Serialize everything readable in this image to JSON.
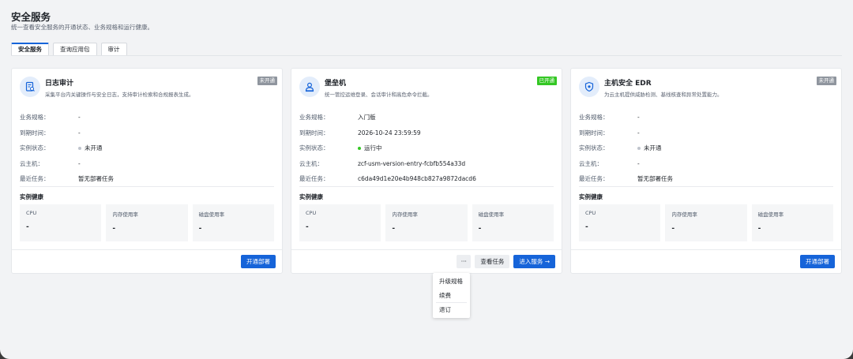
{
  "page": {
    "title": "安全服务",
    "subtitle": "统一查看安全服务的开通状态、业务规格和运行健康。"
  },
  "tabs": [
    {
      "label": "安全服务",
      "active": true
    },
    {
      "label": "查询应用包",
      "active": false
    },
    {
      "label": "审计",
      "active": false
    }
  ],
  "row_labels": {
    "spec": "业务规格：",
    "expire": "到期时间：",
    "status": "实例状态：",
    "host": "云主机：",
    "task": "最近任务："
  },
  "health": {
    "title": "实例健康",
    "cpu": "CPU",
    "mem": "内存使用率",
    "disk": "磁盘使用率"
  },
  "cards": [
    {
      "name": "日志审计",
      "desc": "采集平台内关键操作与安全日志，支持审计检索和合规报表生成。",
      "icon": "log-audit-icon",
      "badge": "未开通",
      "spec": "-",
      "expire": "-",
      "status": "未开通",
      "host": "-",
      "task": "暂无部署任务",
      "cpu": "-",
      "mem": "-",
      "disk": "-",
      "primary_button": "开通部署"
    },
    {
      "name": "堡垒机",
      "desc": "统一管控运维登录、会话审计和高危命令拦截。",
      "icon": "bastion-host-icon",
      "badge": "已开通",
      "spec": "入门版",
      "expire": "2026-10-24 23:59:59",
      "status": "运行中",
      "host": "zcf-usm-version-entry-fcbfb554a33d",
      "task": "c6da49d1e20e4b948cb827a9872dacd6",
      "cpu": "-",
      "mem": "-",
      "disk": "-",
      "more_button": "···",
      "view_tasks_button": "查看任务",
      "primary_button": "进入服务 →"
    },
    {
      "name": "主机安全 EDR",
      "desc": "为云主机提供威胁检测、基线核查和异常处置能力。",
      "icon": "shield-icon",
      "badge": "未开通",
      "spec": "-",
      "expire": "-",
      "status": "未开通",
      "host": "-",
      "task": "暂无部署任务",
      "cpu": "-",
      "mem": "-",
      "disk": "-",
      "primary_button": "开通部署"
    }
  ],
  "dropdown": {
    "items": [
      "升级规格",
      "续费",
      "退订"
    ]
  },
  "colors": {
    "accent": "#1664d9",
    "active_badge": "#34c724",
    "inactive_badge": "#8f959e"
  }
}
